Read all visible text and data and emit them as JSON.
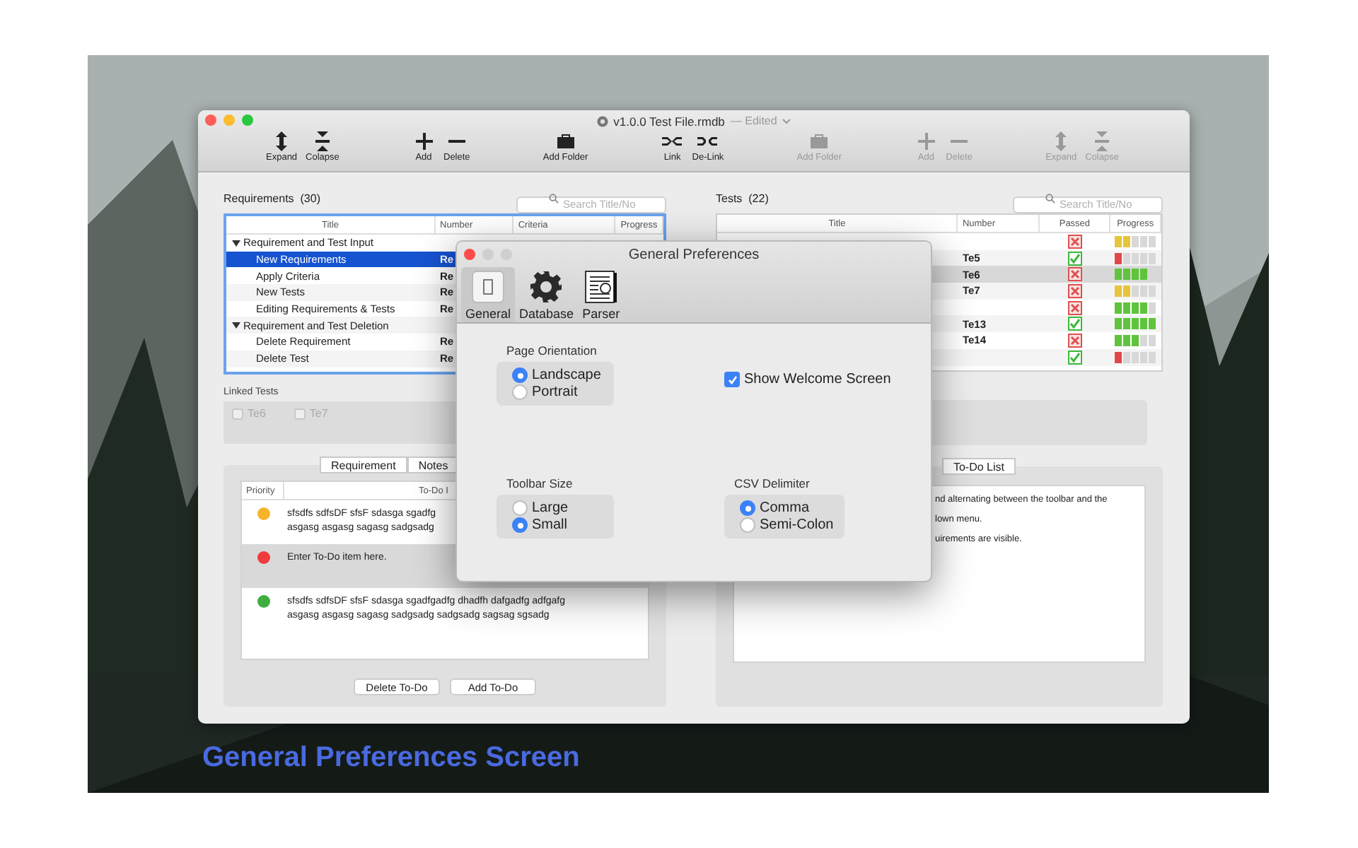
{
  "window": {
    "title": "v1.0.0 Test File.rmdb",
    "status": "— Edited"
  },
  "toolbar": {
    "groups": [
      [
        {
          "label": "Expand",
          "kind": "expand",
          "disabled": false
        },
        {
          "label": "Colapse",
          "kind": "collapse",
          "disabled": false
        }
      ],
      [
        {
          "label": "Add",
          "kind": "add",
          "disabled": false
        },
        {
          "label": "Delete",
          "kind": "delete",
          "disabled": false
        }
      ],
      [
        {
          "label": "Add Folder",
          "kind": "folder",
          "disabled": false
        }
      ],
      [
        {
          "label": "Link",
          "kind": "link",
          "disabled": false
        },
        {
          "label": "De-Link",
          "kind": "delink",
          "disabled": false
        }
      ],
      [
        {
          "label": "Add Folder",
          "kind": "folder",
          "disabled": true
        }
      ],
      [
        {
          "label": "Add",
          "kind": "add",
          "disabled": true
        },
        {
          "label": "Delete",
          "kind": "delete",
          "disabled": true
        }
      ],
      [
        {
          "label": "Expand",
          "kind": "expand",
          "disabled": true
        },
        {
          "label": "Colapse",
          "kind": "collapse",
          "disabled": true
        }
      ]
    ]
  },
  "requirements": {
    "title": "Requirements",
    "count": "(30)",
    "search": {
      "placeholder": "Search Title/No"
    },
    "columns": [
      "Title",
      "Number",
      "Criteria",
      "Progress"
    ],
    "groups": [
      {
        "title": "Requirement and Test Input",
        "expanded": true,
        "children": [
          {
            "title": "New Requirements",
            "number": "Re",
            "selected": true
          },
          {
            "title": "Apply Criteria",
            "number": "Re",
            "selected": false
          },
          {
            "title": "New Tests",
            "number": "Re",
            "selected": false
          },
          {
            "title": "Editing Requirements & Tests",
            "number": "Re",
            "selected": false
          }
        ]
      },
      {
        "title": "Requirement and Test Deletion",
        "expanded": true,
        "children": [
          {
            "title": "Delete Requirement",
            "number": "Re",
            "selected": false
          },
          {
            "title": "Delete Test",
            "number": "Re",
            "selected": false
          }
        ]
      }
    ]
  },
  "linked_tests": {
    "label": "Linked Tests",
    "items": [
      {
        "label": "Te6",
        "checked": false,
        "disabled": true
      },
      {
        "label": "Te7",
        "checked": false,
        "disabled": true
      }
    ]
  },
  "todo_panel": {
    "tabs": [
      {
        "label": "Requirement",
        "selected": false
      },
      {
        "label": "Notes",
        "selected": false
      }
    ],
    "columns": [
      "Priority",
      "To-Do I"
    ],
    "todos": [
      {
        "color": "#f5b42a",
        "lines": [
          "sfsdfs sdfsDF sfsF sdasga sgadfg",
          "asgasg asgasg sagasg sadgsadg"
        ],
        "selected": false
      },
      {
        "color": "#ee3b3b",
        "lines": [
          "Enter To-Do item here."
        ],
        "selected": true
      },
      {
        "color": "#3fae3f",
        "lines": [
          "sfsdfs sdfsDF sfsF sdasga sgadfgadfg dhadfh dafgadfg adfgafg",
          "asgasg asgasg sagasg sadgsadg sadgsadg sagsag sgsadg"
        ],
        "selected": false
      }
    ],
    "buttons": [
      "Delete To-Do",
      "Add To-Do"
    ]
  },
  "tests": {
    "title": "Tests",
    "count": "(22)",
    "search": {
      "placeholder": "Search Title/No"
    },
    "columns": [
      "Title",
      "Number",
      "Passed",
      "Progress"
    ],
    "rows": [
      {
        "number": "",
        "passed": false,
        "level": 0.4,
        "color": "#e6c43c",
        "selected": false
      },
      {
        "number": "Te5",
        "passed": true,
        "level": 0.2,
        "color": "#e04848",
        "selected": false
      },
      {
        "number": "Te6",
        "passed": false,
        "level": 0.8,
        "color": "#5fc43c",
        "selected": true
      },
      {
        "number": "Te7",
        "passed": false,
        "level": 0.4,
        "color": "#e6c43c",
        "selected": false
      },
      {
        "number": "",
        "passed": false,
        "level": 0.8,
        "color": "#5fc43c",
        "selected": false
      },
      {
        "number": "Te13",
        "passed": true,
        "level": 1,
        "color": "#5fc43c",
        "selected": false
      },
      {
        "number": "Te14",
        "passed": false,
        "level": 0.6,
        "color": "#5fc43c",
        "selected": false
      },
      {
        "number": "",
        "passed": true,
        "level": 0.2,
        "color": "#e04848",
        "selected": false
      }
    ]
  },
  "notes_panel": {
    "tabs": [
      {
        "label": "To-Do List",
        "selected": false
      }
    ],
    "lines": [
      "nd alternating between the toolbar and the",
      "lown menu.",
      "uirements are visible."
    ]
  },
  "dialog": {
    "title": "General Preferences",
    "tabs": [
      {
        "label": "General",
        "kind": "general",
        "selected": true
      },
      {
        "label": "Database",
        "kind": "database",
        "selected": false
      },
      {
        "label": "Parser",
        "kind": "parser",
        "selected": false
      }
    ],
    "groups": [
      {
        "kind": "radio",
        "label": "Page Orientation",
        "options": [
          {
            "label": "Landscape",
            "selected": true
          },
          {
            "label": "Portrait",
            "selected": false
          }
        ]
      },
      {
        "kind": "checkbox",
        "label": "Show Welcome Screen",
        "checked": true
      },
      {
        "kind": "radio",
        "label": "Toolbar Size",
        "options": [
          {
            "label": "Large",
            "selected": false
          },
          {
            "label": "Small",
            "selected": true
          }
        ]
      },
      {
        "kind": "radio",
        "label": "CSV Delimiter",
        "options": [
          {
            "label": "Comma",
            "selected": true
          },
          {
            "label": "Semi-Colon",
            "selected": false
          }
        ]
      }
    ]
  },
  "caption": "General Preferences Screen"
}
